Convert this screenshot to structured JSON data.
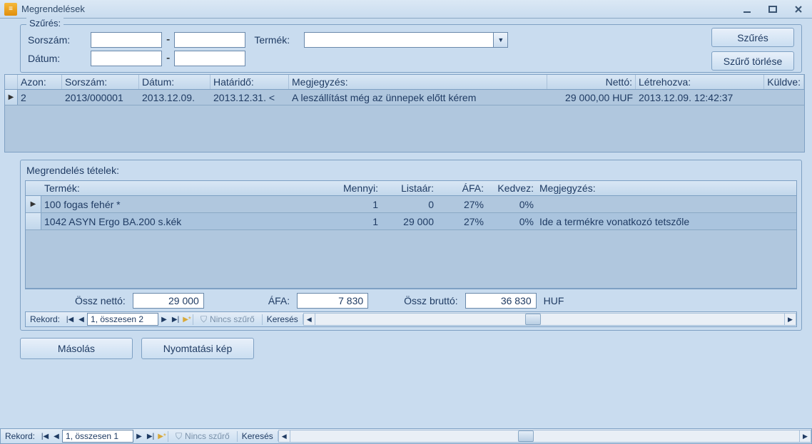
{
  "window": {
    "title": "Megrendelések"
  },
  "filter": {
    "group_title": "Szűrés:",
    "sorszam_label": "Sorszám:",
    "datum_label": "Dátum:",
    "termek_label": "Termék:",
    "szures_btn": "Szűrés",
    "torles_btn": "Szűrő törlése"
  },
  "grid": {
    "headers": {
      "azon": "Azon:",
      "sorszam": "Sorszám:",
      "datum": "Dátum:",
      "hatarido": "Határidő:",
      "megj": "Megjegyzés:",
      "netto": "Nettó:",
      "letrehozva": "Létrehozva:",
      "kuldve": "Küldve:"
    },
    "rows": [
      {
        "azon": "2",
        "sorszam": "2013/000001",
        "datum": "2013.12.09.",
        "hatarido": "2013.12.31. <",
        "megj": "A leszállítást még az ünnepek előtt kérem",
        "netto": "29 000,00 HUF",
        "letrehozva": "2013.12.09. 12:42:37",
        "kuldve": ""
      }
    ]
  },
  "items": {
    "group_title": "Megrendelés tételek:",
    "headers": {
      "termek": "Termék:",
      "menny": "Mennyi:",
      "listaar": "Listaár:",
      "afa": "ÁFA:",
      "kedvez": "Kedvez:",
      "megj": "Megjegyzés:"
    },
    "rows": [
      {
        "termek": "100 fogas fehér *",
        "menny": "1",
        "listaar": "0",
        "afa": "27%",
        "kedvez": "0%",
        "megj": ""
      },
      {
        "termek": "1042 ASYN Ergo BA.200 s.kék",
        "menny": "1",
        "listaar": "29 000",
        "afa": "27%",
        "kedvez": "0%",
        "megj": "Ide a termékre vonatkozó tetszőle"
      }
    ]
  },
  "totals": {
    "ossz_netto_label": "Össz nettó:",
    "ossz_netto": "29 000",
    "afa_label": "ÁFA:",
    "afa": "7 830",
    "ossz_brutto_label": "Össz bruttó:",
    "ossz_brutto": "36 830",
    "currency": "HUF"
  },
  "nav_inner": {
    "rekord": "Rekord:",
    "pos": "1, összesen 2",
    "filter": "Nincs szűrő",
    "search": "Keresés"
  },
  "nav_outer": {
    "rekord": "Rekord:",
    "pos": "1, összesen 1",
    "filter": "Nincs szűrő",
    "search": "Keresés"
  },
  "actions": {
    "masolas": "Másolás",
    "nyomtat": "Nyomtatási kép"
  }
}
